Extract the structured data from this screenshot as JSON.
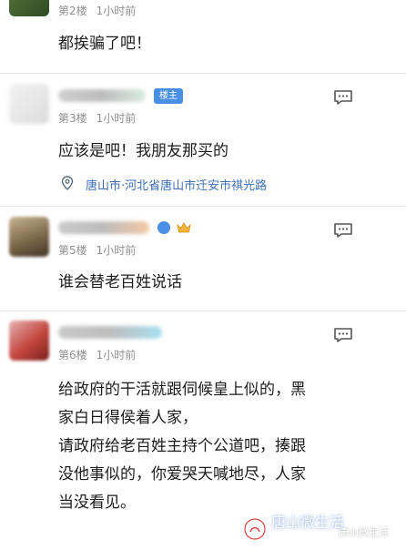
{
  "posts": [
    {
      "floor": "第2楼",
      "time": "1小时前",
      "content": [
        "都挨骗了吧！"
      ]
    },
    {
      "floor": "第3楼",
      "time": "1小时前",
      "badge": "楼主",
      "content": [
        "应该是吧！我朋友那买的"
      ],
      "location": "唐山市·河北省唐山市迁安市祺光路"
    },
    {
      "floor": "第5楼",
      "time": "1小时前",
      "content": [
        "谁会替老百姓说话"
      ]
    },
    {
      "floor": "第6楼",
      "time": "1小时前",
      "content": [
        "给政府的干活就跟伺候皇上似的，黑",
        "家白日得侯着人家，",
        "请政府给老百姓主持个公道吧，揍跟",
        "没他事似的，你爱哭天喊地尽，人家",
        "当没看见。"
      ]
    }
  ],
  "watermark": {
    "title": "唐山微生活",
    "subtitle": "唐山微生活"
  },
  "icons": {
    "reply": "comment-icon",
    "location": "location-pin-icon",
    "crown": "crown-icon"
  },
  "colors": {
    "accent": "#4a8fe6",
    "location": "#3d6fb6",
    "meta": "#8f8f8f"
  }
}
